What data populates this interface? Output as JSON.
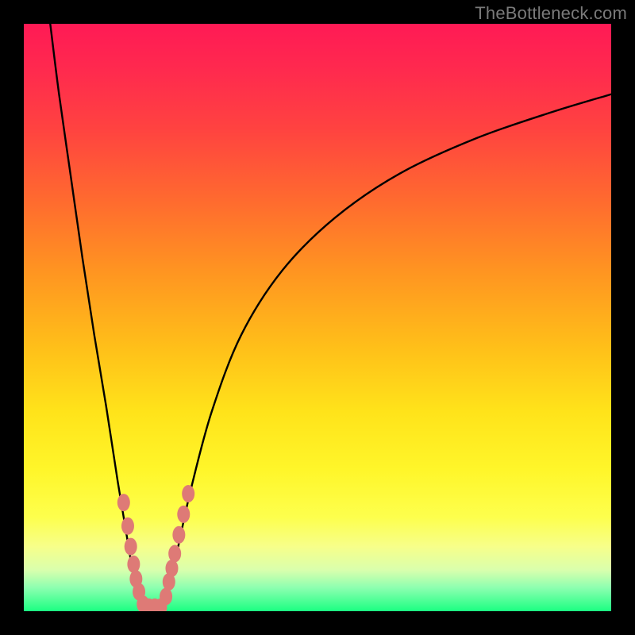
{
  "watermark": "TheBottleneck.com",
  "chart_data": {
    "type": "line",
    "title": "",
    "xlabel": "",
    "ylabel": "",
    "xlim": [
      0,
      100
    ],
    "ylim": [
      0,
      100
    ],
    "grid": false,
    "legend": false,
    "background_gradient": {
      "top": "#ff1a55",
      "middle": "#ffe31a",
      "bottom": "#1bff82"
    },
    "series": [
      {
        "name": "left-branch",
        "x": [
          4.5,
          6,
          8,
          10,
          12,
          14,
          16,
          17.5,
          18.5,
          19.3,
          20.0,
          20.5
        ],
        "y": [
          100,
          88,
          74,
          60,
          47,
          35,
          22,
          13,
          7,
          3,
          1,
          0
        ]
      },
      {
        "name": "right-branch",
        "x": [
          23.5,
          24.2,
          25.2,
          26.5,
          28.5,
          32,
          37,
          44,
          53,
          64,
          77,
          90,
          100
        ],
        "y": [
          0,
          2,
          6,
          12,
          21,
          34,
          47,
          58,
          67,
          74.5,
          80.5,
          85,
          88
        ]
      }
    ],
    "marker_points": {
      "color": "#de7a76",
      "points": [
        {
          "x": 17.0,
          "y": 18.5
        },
        {
          "x": 17.7,
          "y": 14.5
        },
        {
          "x": 18.2,
          "y": 11.0
        },
        {
          "x": 18.7,
          "y": 8.0
        },
        {
          "x": 19.1,
          "y": 5.5
        },
        {
          "x": 19.6,
          "y": 3.3
        },
        {
          "x": 20.3,
          "y": 1.2
        },
        {
          "x": 21.3,
          "y": 0.7
        },
        {
          "x": 22.3,
          "y": 0.7
        },
        {
          "x": 23.3,
          "y": 0.7
        },
        {
          "x": 24.2,
          "y": 2.5
        },
        {
          "x": 24.7,
          "y": 5.0
        },
        {
          "x": 25.2,
          "y": 7.3
        },
        {
          "x": 25.7,
          "y": 9.8
        },
        {
          "x": 26.4,
          "y": 13.0
        },
        {
          "x": 27.2,
          "y": 16.5
        },
        {
          "x": 28.0,
          "y": 20.0
        }
      ]
    }
  }
}
